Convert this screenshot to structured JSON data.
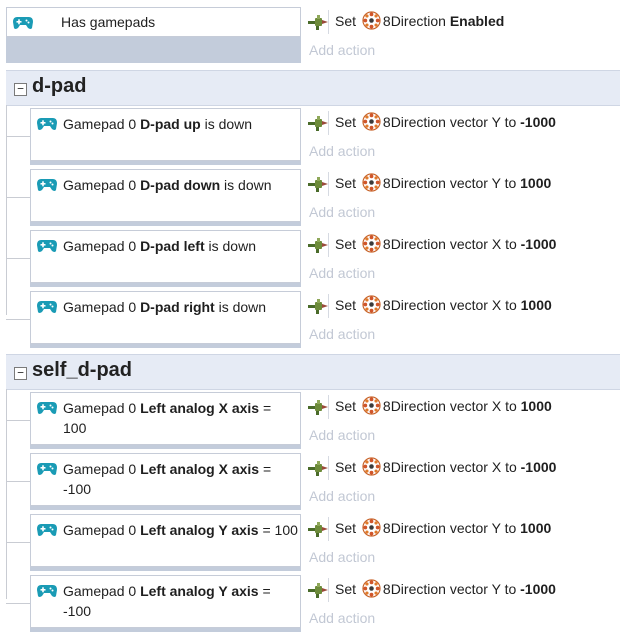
{
  "top_event": {
    "condition": "Has gamepads",
    "action": {
      "prefix": "Set",
      "object": "8Direction",
      "bold": "Enabled"
    },
    "add_action": "Add action"
  },
  "groups": [
    {
      "title": "d-pad",
      "toggle": "−",
      "events": [
        {
          "pre": "Gamepad 0 ",
          "bold": "D-pad up",
          "post": " is down",
          "act_pre": "Set",
          "act_obj": "8Direction",
          "act_mid": " vector Y to ",
          "act_val": "-1000",
          "add_action": "Add action"
        },
        {
          "pre": "Gamepad 0 ",
          "bold": "D-pad down",
          "post": " is down",
          "act_pre": "Set",
          "act_obj": "8Direction",
          "act_mid": " vector Y to ",
          "act_val": "1000",
          "add_action": "Add action"
        },
        {
          "pre": "Gamepad 0 ",
          "bold": "D-pad left",
          "post": " is down",
          "act_pre": "Set",
          "act_obj": "8Direction",
          "act_mid": " vector X to ",
          "act_val": "-1000",
          "add_action": "Add action"
        },
        {
          "pre": "Gamepad 0 ",
          "bold": "D-pad right",
          "post": " is down",
          "act_pre": "Set",
          "act_obj": "8Direction",
          "act_mid": " vector X to ",
          "act_val": "1000",
          "add_action": "Add action"
        }
      ]
    },
    {
      "title": "self_d-pad",
      "toggle": "−",
      "events": [
        {
          "pre": "Gamepad 0 ",
          "bold": "Left analog X axis",
          "post": " = 100",
          "act_pre": "Set",
          "act_obj": "8Direction",
          "act_mid": " vector X to ",
          "act_val": "1000",
          "add_action": "Add action"
        },
        {
          "pre": "Gamepad 0 ",
          "bold": "Left analog X axis",
          "post": " = -100",
          "act_pre": "Set",
          "act_obj": "8Direction",
          "act_mid": " vector X to ",
          "act_val": "-1000",
          "add_action": "Add action"
        },
        {
          "pre": "Gamepad 0 ",
          "bold": "Left analog Y axis",
          "post": " = 100",
          "act_pre": "Set",
          "act_obj": "8Direction",
          "act_mid": " vector Y to ",
          "act_val": "1000",
          "add_action": "Add action"
        },
        {
          "pre": "Gamepad 0 ",
          "bold": "Left analog Y axis",
          "post": " = -100",
          "act_pre": "Set",
          "act_obj": "8Direction",
          "act_mid": " vector Y to ",
          "act_val": "-1000",
          "add_action": "Add action"
        }
      ]
    }
  ],
  "icons": {
    "condition": "gamepad-icon",
    "action": "behavior-set-icon",
    "object": "8direction-icon"
  },
  "colors": {
    "gamepad": "#1a9bb5",
    "group_header": "#e6ebf5",
    "event_block": "#c3ccdb",
    "add_action_text": "#c2c8d4"
  }
}
